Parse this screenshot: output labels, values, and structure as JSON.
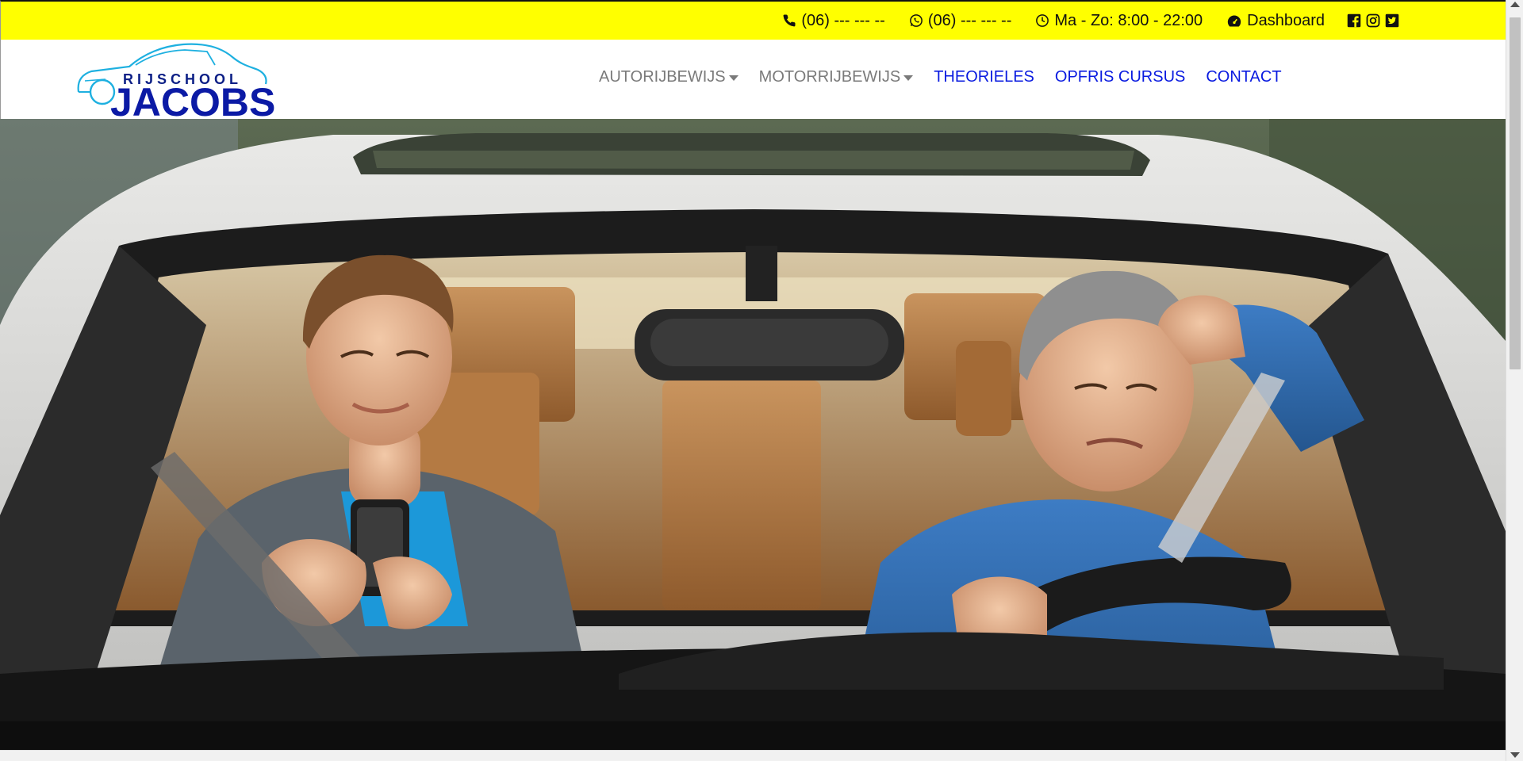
{
  "topbar": {
    "phone": "(06) --- --- --",
    "whatsapp": "(06) --- --- --",
    "hours": "Ma - Zo: 8:00 - 22:00",
    "dashboard": "Dashboard",
    "socials": [
      "facebook-icon",
      "instagram-icon",
      "twitter-icon"
    ]
  },
  "logo": {
    "rijschool": "RIJSCHOOL",
    "jacobs": "JACOBS"
  },
  "nav": {
    "items": [
      {
        "label": "AUTORIJBEWIJS",
        "dropdown": true
      },
      {
        "label": "MOTORRIJBEWIJS",
        "dropdown": true
      },
      {
        "label": "THEORIELES",
        "dropdown": false
      },
      {
        "label": "OPFRIS CURSUS",
        "dropdown": false
      },
      {
        "label": "CONTACT",
        "dropdown": false
      }
    ]
  },
  "colors": {
    "topbar_bg": "#ffff00",
    "brand_blue": "#0b1aa5",
    "nav_link": "#0a1be0",
    "nav_muted": "#7a7a7a"
  }
}
